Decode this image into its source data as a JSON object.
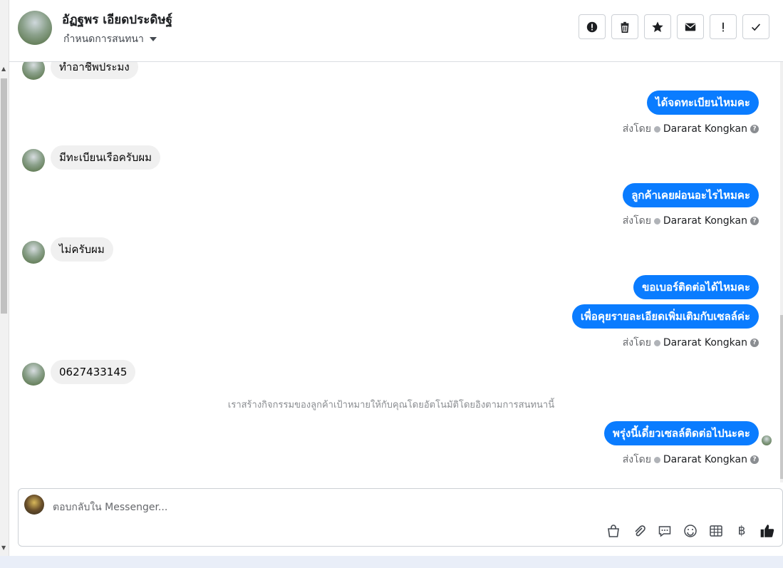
{
  "header": {
    "contact_name": "อัฏฐพร เอียดประดิษฐ์",
    "assign_label": "กำหนดการสนทนา"
  },
  "toolbar": [
    "spam-icon",
    "trash-icon",
    "star-icon",
    "mail-icon",
    "exclamation-icon",
    "check-icon"
  ],
  "messages": {
    "in_1": "ทำอาชีพประมง",
    "out_1": "ได้จดทะเบียนไหมคะ",
    "in_2": "มีทะเบียนเรือครับผม",
    "out_2": "ลูกค้าเคยผ่อนอะไรไหมคะ",
    "in_3": "ไม่ครับผม",
    "out_3a": "ขอเบอร์ติดต่อได้ไหมคะ",
    "out_3b": "เพื่อคุยรายละเอียดเพิ่มเติมกับเซลล์ค่ะ",
    "in_4": "0627433145",
    "system_note": "เราสร้างกิจกรรมของลูกค้าเป้าหมายให้กับคุณโดยอัตโนมัติโดยอิงตามการสนทนานี้",
    "out_4": "พรุ่งนี้เดี๋ยวเซลล์ติดต่อไปนะคะ"
  },
  "sent_by": {
    "prefix": "ส่งโดย",
    "agent": "Dararat Kongkan"
  },
  "reply": {
    "placeholder": "ตอบกลับใน Messenger...",
    "tools": [
      "bag-icon",
      "attach-icon",
      "comment-icon",
      "emoji-icon",
      "table-icon",
      "baht-icon",
      "like-icon"
    ],
    "baht_glyph": "฿"
  },
  "colors": {
    "outgoing_bubble": "#0a7cff",
    "incoming_bubble": "#f0f0f0"
  }
}
